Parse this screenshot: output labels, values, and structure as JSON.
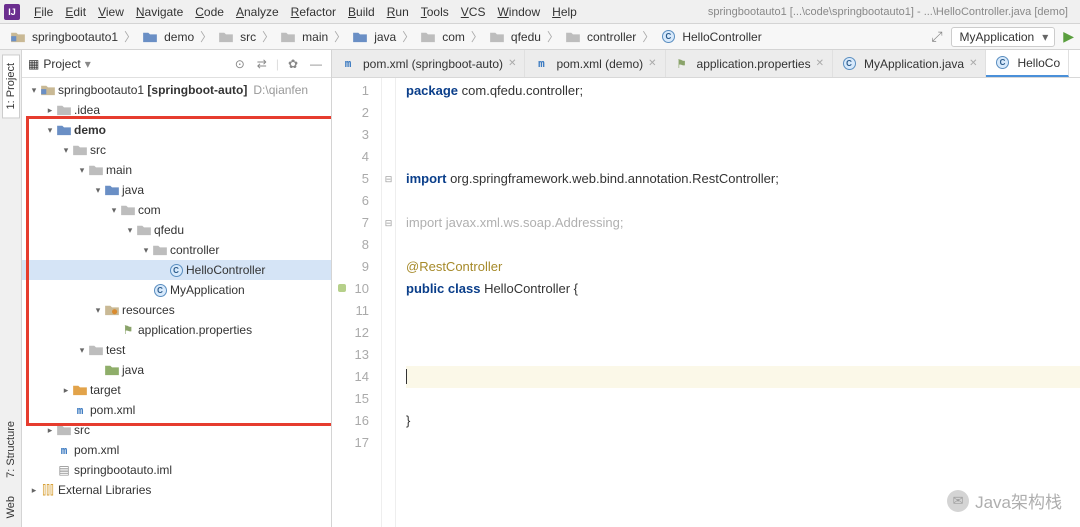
{
  "title": "springbootauto1 [...\\code\\springbootauto1] - ...\\HelloController.java [demo]",
  "menu": [
    "File",
    "Edit",
    "View",
    "Navigate",
    "Code",
    "Analyze",
    "Refactor",
    "Build",
    "Run",
    "Tools",
    "VCS",
    "Window",
    "Help"
  ],
  "breadcrumbs": [
    {
      "icon": "module",
      "label": "springbootauto1"
    },
    {
      "icon": "module-blue",
      "label": "demo"
    },
    {
      "icon": "folder",
      "label": "src"
    },
    {
      "icon": "folder",
      "label": "main"
    },
    {
      "icon": "folder-blue",
      "label": "java"
    },
    {
      "icon": "folder",
      "label": "com"
    },
    {
      "icon": "folder",
      "label": "qfedu"
    },
    {
      "icon": "folder",
      "label": "controller"
    },
    {
      "icon": "class",
      "label": "HelloController"
    }
  ],
  "run_config": "MyApplication",
  "tree_header": "Project",
  "tree": [
    {
      "depth": 0,
      "arrow": "v",
      "icon": "module",
      "label": "springbootauto1",
      "bold_suffix": "[springboot-auto]",
      "hint": "D:\\qianfen"
    },
    {
      "depth": 1,
      "arrow": ">",
      "icon": "folder",
      "label": ".idea"
    },
    {
      "depth": 1,
      "arrow": "v",
      "icon": "module-blue",
      "label": "demo",
      "bold": true
    },
    {
      "depth": 2,
      "arrow": "v",
      "icon": "folder",
      "label": "src"
    },
    {
      "depth": 3,
      "arrow": "v",
      "icon": "folder",
      "label": "main"
    },
    {
      "depth": 4,
      "arrow": "v",
      "icon": "folder-blue",
      "label": "java"
    },
    {
      "depth": 5,
      "arrow": "v",
      "icon": "folder",
      "label": "com"
    },
    {
      "depth": 6,
      "arrow": "v",
      "icon": "folder",
      "label": "qfedu"
    },
    {
      "depth": 7,
      "arrow": "v",
      "icon": "folder",
      "label": "controller"
    },
    {
      "depth": 8,
      "arrow": "",
      "icon": "class",
      "label": "HelloController",
      "selected": true
    },
    {
      "depth": 7,
      "arrow": "",
      "icon": "class",
      "label": "MyApplication"
    },
    {
      "depth": 4,
      "arrow": "v",
      "icon": "folder-res",
      "label": "resources"
    },
    {
      "depth": 5,
      "arrow": "",
      "icon": "prop",
      "label": "application.properties"
    },
    {
      "depth": 3,
      "arrow": "v",
      "icon": "folder",
      "label": "test"
    },
    {
      "depth": 4,
      "arrow": "",
      "icon": "folder-green",
      "label": "java"
    },
    {
      "depth": 2,
      "arrow": ">",
      "icon": "folder-orange",
      "label": "target"
    },
    {
      "depth": 2,
      "arrow": "",
      "icon": "m",
      "label": "pom.xml"
    },
    {
      "depth": 1,
      "arrow": ">",
      "icon": "folder",
      "label": "src"
    },
    {
      "depth": 1,
      "arrow": "",
      "icon": "m",
      "label": "pom.xml"
    },
    {
      "depth": 1,
      "arrow": "",
      "icon": "iml",
      "label": "springbootauto.iml"
    },
    {
      "depth": 0,
      "arrow": ">",
      "icon": "lib",
      "label": "External Libraries"
    }
  ],
  "editor_tabs": [
    {
      "icon": "m",
      "label": "pom.xml (springboot-auto)",
      "active": false
    },
    {
      "icon": "m",
      "label": "pom.xml (demo)",
      "active": false
    },
    {
      "icon": "prop",
      "label": "application.properties",
      "active": false
    },
    {
      "icon": "class",
      "label": "MyApplication.java",
      "active": false
    },
    {
      "icon": "class",
      "label": "HelloCo",
      "active": true,
      "truncated": true
    }
  ],
  "code": {
    "lines": [
      {
        "n": 1,
        "html": "<span class='kw'>package</span> com.qfedu.controller;"
      },
      {
        "n": 2,
        "html": ""
      },
      {
        "n": 3,
        "html": ""
      },
      {
        "n": 4,
        "html": ""
      },
      {
        "n": 5,
        "fold": "⊟",
        "html": "<span class='kw'>import</span> org.springframework.web.bind.annotation.<span class='cls'>RestController</span>;"
      },
      {
        "n": 6,
        "html": ""
      },
      {
        "n": 7,
        "fold": "⊟",
        "html": "<span class='gray'>import javax.xml.ws.soap.Addressing;</span>"
      },
      {
        "n": 8,
        "html": ""
      },
      {
        "n": 9,
        "html": "<span class='ann'>@RestController</span>"
      },
      {
        "n": 10,
        "mark": true,
        "html": "<span class='kw'>public</span> <span class='kw'>class</span> HelloController {"
      },
      {
        "n": 11,
        "html": ""
      },
      {
        "n": 12,
        "html": ""
      },
      {
        "n": 13,
        "html": ""
      },
      {
        "n": 14,
        "cur": true,
        "html": "<span class='caret'></span>"
      },
      {
        "n": 15,
        "html": ""
      },
      {
        "n": 16,
        "html": "}"
      },
      {
        "n": 17,
        "html": ""
      }
    ]
  },
  "side_tabs_left": [
    "1: Project",
    "7: Structure",
    "Web"
  ],
  "watermark": "Java架构栈"
}
